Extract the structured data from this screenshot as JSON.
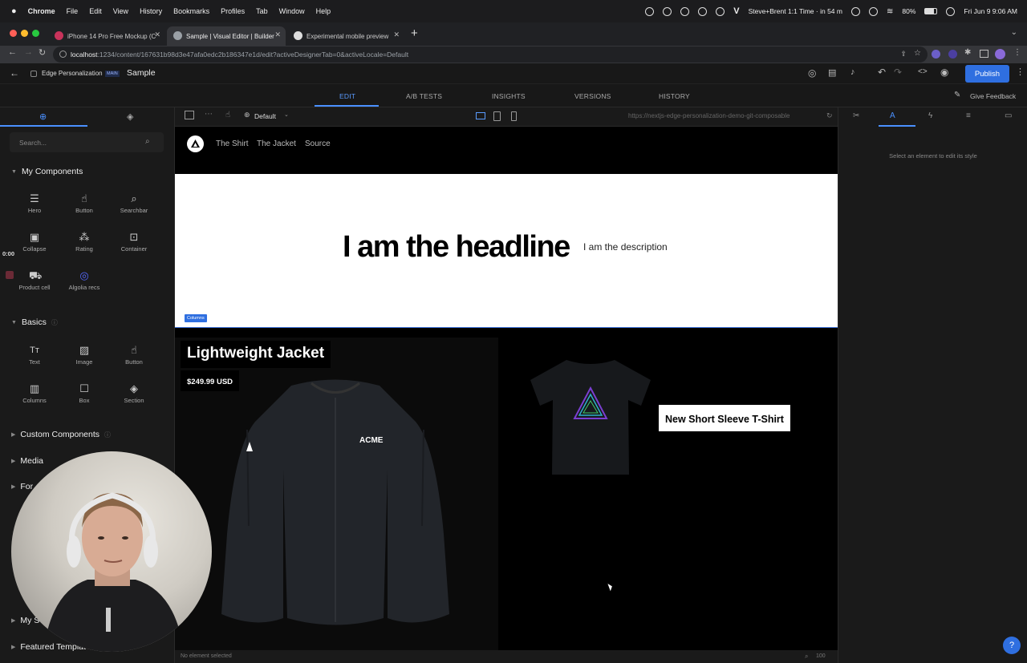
{
  "menubar": {
    "app": "Chrome",
    "items": [
      "File",
      "Edit",
      "View",
      "History",
      "Bookmarks",
      "Profiles",
      "Tab",
      "Window",
      "Help"
    ],
    "meeting": "Steve+Brent 1:1 Time · in 54 m",
    "battery": "80%",
    "datetime": "Fri Jun 9  9:06 AM"
  },
  "tabs": [
    {
      "title": "iPhone 14 Pro Free Mockup (C",
      "active": false
    },
    {
      "title": "Sample | Visual Editor | Builder",
      "active": true
    },
    {
      "title": "Experimental mobile preview",
      "active": false
    }
  ],
  "url": {
    "host": "localhost",
    "rest": ":1234/content/167631b98d3e47afa0edc2b186347e1d/edit?activeDesignerTab=0&activeLocale=Default"
  },
  "builder": {
    "space": "Edge Personalization",
    "branch": "MAIN",
    "page": "Sample",
    "publish": "Publish",
    "feedback": "Give Feedback",
    "subnav": [
      "EDIT",
      "A/B TESTS",
      "INSIGHTS",
      "VERSIONS",
      "HISTORY"
    ]
  },
  "leftpanel": {
    "search_placeholder": "Search...",
    "timer": "0:00",
    "my_components_title": "My Components",
    "my_components": [
      {
        "label": "Hero",
        "icon": "hero-icon"
      },
      {
        "label": "Button",
        "icon": "hand-pointer-icon"
      },
      {
        "label": "Searchbar",
        "icon": "search-icon"
      },
      {
        "label": "Collapse",
        "icon": "collapse-icon"
      },
      {
        "label": "Rating",
        "icon": "stars-icon"
      },
      {
        "label": "Container",
        "icon": "container-icon"
      },
      {
        "label": "Product cell",
        "icon": "cart-icon"
      },
      {
        "label": "Algolia recs",
        "icon": "algolia-icon"
      }
    ],
    "basics_title": "Basics",
    "basics": [
      {
        "label": "Text",
        "icon": "text-icon"
      },
      {
        "label": "Image",
        "icon": "image-icon"
      },
      {
        "label": "Button",
        "icon": "button-icon"
      },
      {
        "label": "Columns",
        "icon": "columns-icon"
      },
      {
        "label": "Box",
        "icon": "box-icon"
      },
      {
        "label": "Section",
        "icon": "section-icon"
      }
    ],
    "custom_title": "Custom Components",
    "media_title": "Media",
    "forms_title": "For",
    "my_s_title": "My S",
    "featured_title": "Featured Templat"
  },
  "canvasbar": {
    "locale": "Default",
    "preview_url": "https://nextjs-edge-personalization-demo-git-composable"
  },
  "site": {
    "nav": [
      "The Shirt",
      "The Jacket",
      "Source"
    ],
    "headline": "I am the headline",
    "description": "I am the description",
    "columns_tag": "Columns",
    "jacket_title": "Lightweight Jacket",
    "jacket_price": "$249.99 USD",
    "jacket_brand": "ACME",
    "shirt_title": "New Short Sleeve T-Shirt"
  },
  "status": {
    "selection": "No element selected",
    "zoom": "100"
  },
  "rightpanel": {
    "hint": "Select an element to edit its style"
  },
  "colors": {
    "accent": "#2f6fe0",
    "chrome_bg": "#202124",
    "panel_bg": "#1a1a1a"
  }
}
